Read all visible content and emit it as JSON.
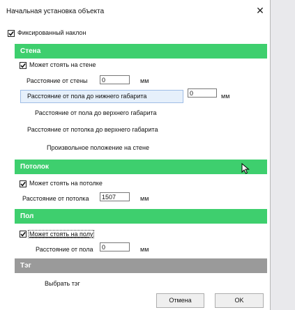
{
  "window": {
    "title": "Начальная установка объекта",
    "close_icon": "close-icon"
  },
  "fixed_tilt": {
    "label": "Фиксированный наклон",
    "checked": true
  },
  "wall": {
    "header": "Стена",
    "can_stand": "Может стоять на стене",
    "dist_from_wall_label": "Расстояние от стены",
    "dist_from_wall_value": "0",
    "unit1": "мм",
    "floor_lower_label": "Расстояние от пола до нижнего габарита",
    "floor_lower_value": "0",
    "unit2": "мм",
    "floor_upper_label": "Расстояние от пола до верхнего габарита",
    "ceiling_upper_label": "Расстояние от потолка до верхнего габарита",
    "arbitrary_label": "Произвольное положение на стене"
  },
  "ceiling": {
    "header": "Потолок",
    "can_stand": "Может стоять на потолке",
    "dist_label": "Расстояние от потолка",
    "dist_value": "1507",
    "unit": "мм"
  },
  "floor": {
    "header": "Пол",
    "can_stand": "Может стоять на полу",
    "dist_label": "Расстояние от пола",
    "dist_value": "0",
    "unit": "мм"
  },
  "tag": {
    "header": "Тэг",
    "choose_label": "Выбрать тэг"
  },
  "buttons": {
    "cancel": "Отмена",
    "ok": "OK"
  },
  "colors": {
    "section_green": "#3ecf6e",
    "section_gray": "#9a9a9a"
  }
}
